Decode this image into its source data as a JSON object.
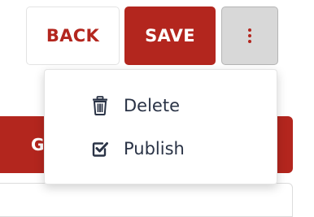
{
  "toolbar": {
    "back_label": "BACK",
    "save_label": "SAVE",
    "more_icon": "more-vertical-icon"
  },
  "background": {
    "primary_button_label": "G"
  },
  "menu": {
    "items": [
      {
        "label": "Delete",
        "icon": "trash-icon"
      },
      {
        "label": "Publish",
        "icon": "checkbox-check-icon"
      }
    ]
  },
  "colors": {
    "accent": "#b3261e",
    "text": "#2a3346",
    "more_button_bg": "#d8d8d8"
  }
}
